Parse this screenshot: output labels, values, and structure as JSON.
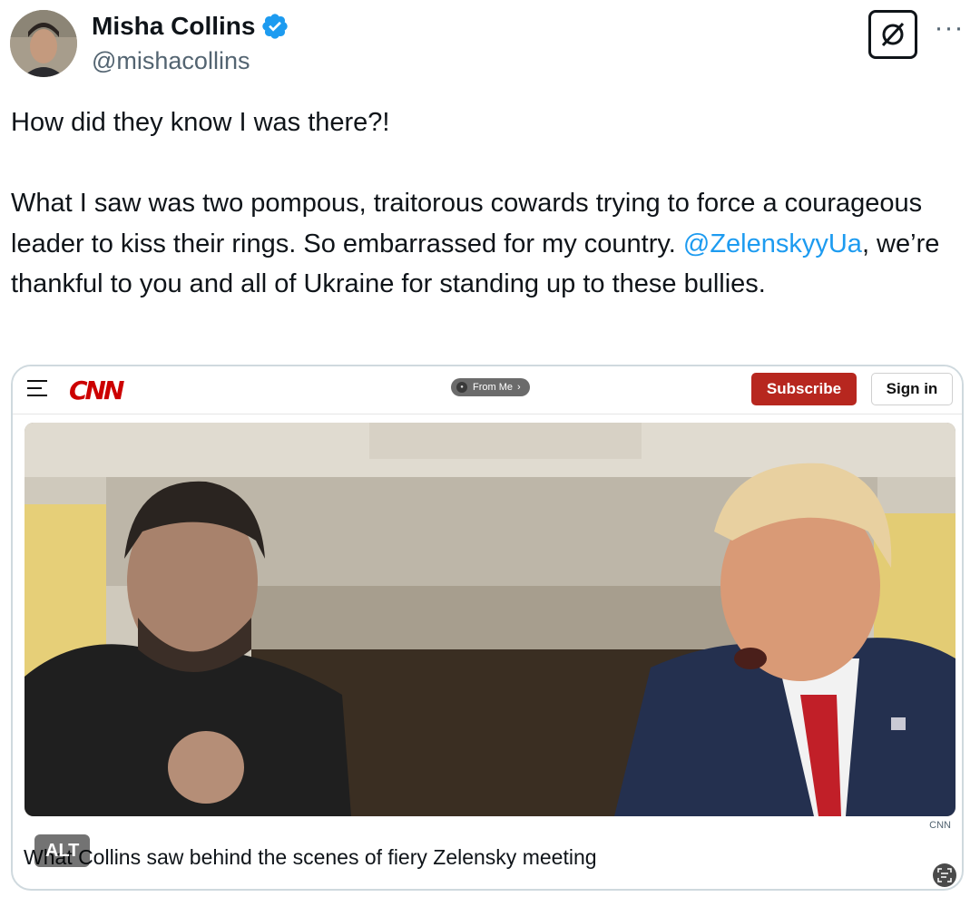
{
  "author": {
    "name": "Misha Collins",
    "handle": "@mishacollins",
    "verified": true
  },
  "header_icons": {
    "grok": "grok-icon",
    "more": "more-icon",
    "more_glyph": "···"
  },
  "tweet": {
    "line1": "How did they know I was there?!",
    "line2_part1": "What I saw was two pompous, traitorous cowards trying to force a courageous leader to kiss their rings. So embarrassed for my country.",
    "mention": "@ZelenskyyUa",
    "line2_part2": ", we’re thankful to you and all of Ukraine for standing up to these bullies."
  },
  "card": {
    "site_logo": "CNN",
    "pill_text": "From Me",
    "subscribe_label": "Subscribe",
    "signin_label": "Sign in",
    "source": "CNN",
    "title": "What Collins saw behind the scenes of fiery Zelensky meeting",
    "alt_label": "ALT"
  },
  "colors": {
    "accent": "#1d9bf0",
    "verified": "#1d9bf0",
    "cnn_red": "#cc0000",
    "subscribe_red": "#b7271f"
  }
}
